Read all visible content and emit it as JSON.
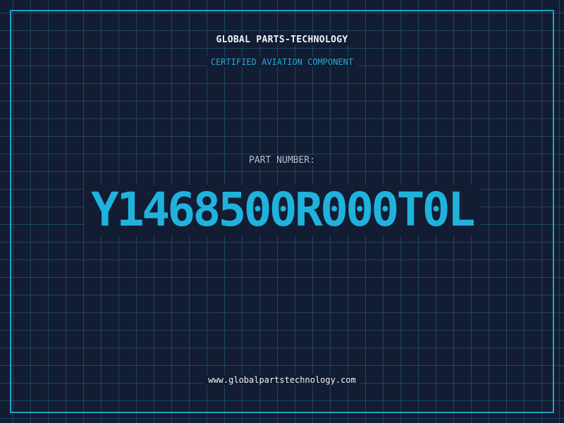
{
  "header": {
    "brand": "GLOBAL PARTS-TECHNOLOGY",
    "subtitle": "CERTIFIED AVIATION COMPONENT"
  },
  "part": {
    "label": "PART NUMBER:",
    "number": "Y1468500R000T0L"
  },
  "footer": {
    "url": "www.globalpartstechnology.com"
  },
  "colors": {
    "background": "#121c33",
    "accent": "#1fb3dc",
    "grid": "#2a7896",
    "text": "#f2f4f8"
  }
}
